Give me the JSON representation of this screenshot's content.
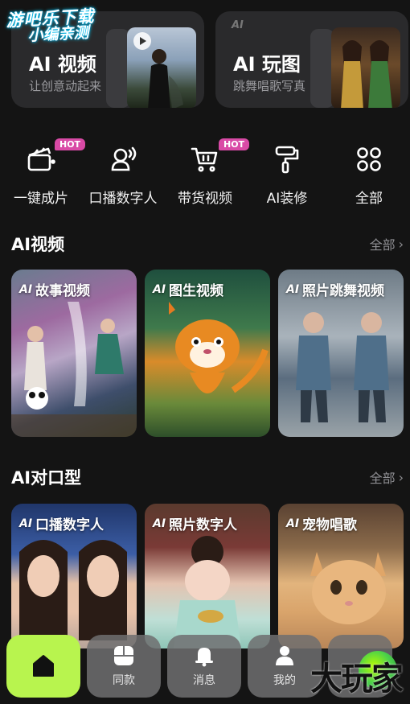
{
  "watermark": {
    "line1": "游吧乐下载",
    "line2": "小编亲测"
  },
  "top_cards": [
    {
      "title": "AI 视频",
      "subtitle": "让创意动起来"
    },
    {
      "tag": "AI",
      "title": "AI 玩图",
      "subtitle": "跳舞唱歌写真"
    }
  ],
  "tools": [
    {
      "label": "一键成片",
      "badge": "HOT",
      "icon": "clapperboard-icon"
    },
    {
      "label": "口播数字人",
      "badge": "",
      "icon": "speaking-avatar-icon"
    },
    {
      "label": "带货视频",
      "badge": "HOT",
      "icon": "shopping-cart-icon"
    },
    {
      "label": "AI装修",
      "badge": "",
      "icon": "paint-roller-icon"
    },
    {
      "label": "全部",
      "badge": "",
      "icon": "grid-icon"
    }
  ],
  "sections": {
    "ai_video": {
      "title": "AI视频",
      "see_all": "全部",
      "cards": [
        {
          "ai": "AI",
          "label": "故事视频"
        },
        {
          "ai": "AI",
          "label": "图生视频"
        },
        {
          "ai": "AI",
          "label": "照片跳舞视频"
        }
      ]
    },
    "ai_lipsync": {
      "title": "AI对口型",
      "see_all": "全部",
      "cards": [
        {
          "ai": "AI",
          "label": "口播数字人"
        },
        {
          "ai": "AI",
          "label": "照片数字人"
        },
        {
          "ai": "AI",
          "label": "宠物唱歌"
        }
      ]
    }
  },
  "bottom_nav": [
    {
      "label": "",
      "icon": "home-icon",
      "active": true
    },
    {
      "label": "同款",
      "icon": "template-icon",
      "active": false
    },
    {
      "label": "消息",
      "icon": "bell-icon",
      "active": false
    },
    {
      "label": "我的",
      "icon": "user-icon",
      "active": false
    }
  ],
  "brand_watermark": "大玩家",
  "colors": {
    "accent": "#b8f44e",
    "hot_badge": "#d94aa6",
    "background": "#141414"
  }
}
